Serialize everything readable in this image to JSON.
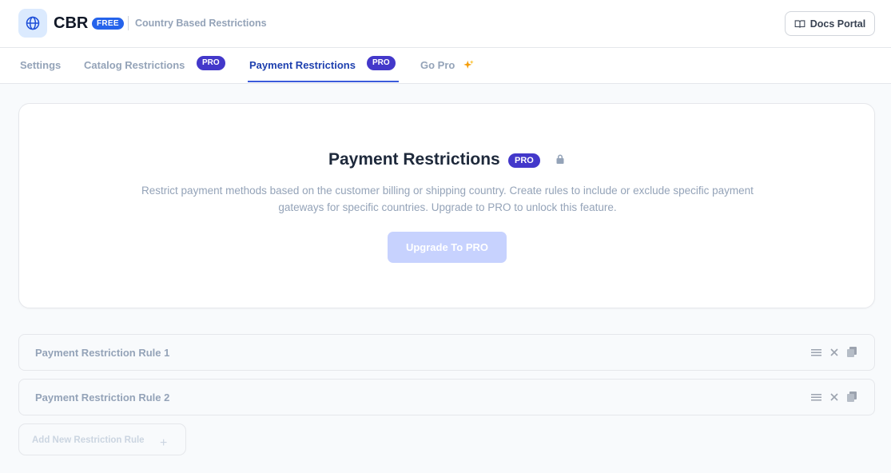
{
  "header": {
    "brand": "CBR",
    "edition_badge": "FREE",
    "subtitle": "Country Based Restrictions",
    "docs_button": "Docs Portal",
    "logo_icon": "globe-icon",
    "docs_icon": "book-icon"
  },
  "tabs": [
    {
      "label": "Settings",
      "active": false
    },
    {
      "label": "Catalog Restrictions",
      "badge": "PRO",
      "active": false
    },
    {
      "label": "Payment Restrictions",
      "badge": "PRO",
      "active": true
    },
    {
      "label": "Go Pro",
      "icon": "sparkles-icon",
      "active": false
    }
  ],
  "hero": {
    "title": "Payment Restrictions",
    "badge": "PRO",
    "lock_icon": "lock-icon",
    "description": "Restrict payment methods based on the customer billing or shipping country. Create rules to include or exclude specific payment gateways for specific countries. Upgrade to PRO to unlock this feature.",
    "cta": "Upgrade To PRO"
  },
  "rules": [
    {
      "label": "Payment Restriction Rule 1"
    },
    {
      "label": "Payment Restriction Rule 2"
    }
  ],
  "add_rule": {
    "label": "Add New Restriction Rule",
    "icon": "plus-icon"
  },
  "colors": {
    "accent": "#4338ca",
    "active_tab": "#1e40af",
    "free_badge": "#2563eb",
    "disabled_button": "#c7d2fe"
  }
}
